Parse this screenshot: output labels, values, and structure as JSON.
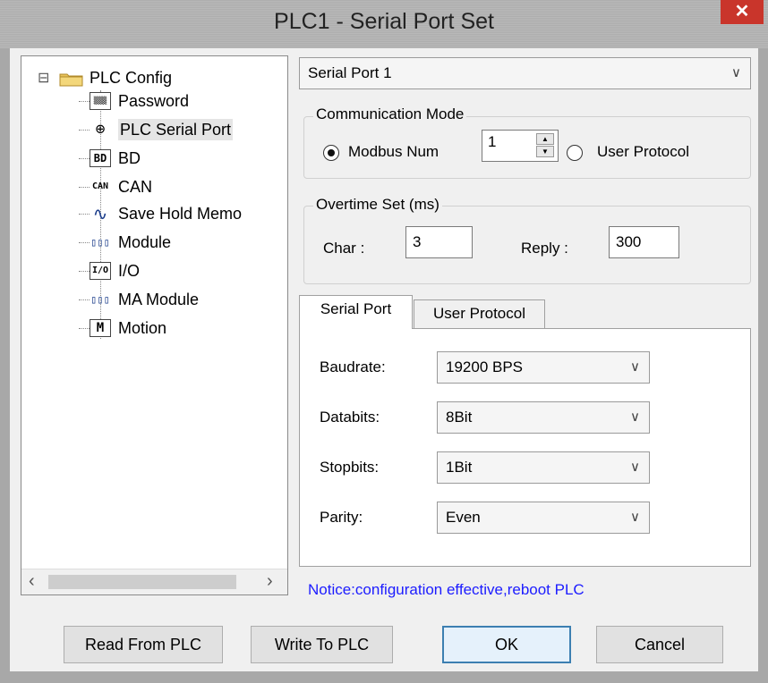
{
  "window": {
    "title": "PLC1 - Serial Port  Set",
    "close_glyph": "✕"
  },
  "tree": {
    "root": {
      "label": "PLC Config",
      "icon": "folder-icon",
      "expander": "⊟"
    },
    "items": [
      {
        "label": "Password",
        "icon_text": "▒▒▒"
      },
      {
        "label": "PLC Serial Port",
        "icon_text": "⊕"
      },
      {
        "label": "BD",
        "icon_text": "BD"
      },
      {
        "label": "CAN",
        "icon_text": "CAN"
      },
      {
        "label": "Save Hold Memo",
        "icon_text": "∿"
      },
      {
        "label": "Module",
        "icon_text": "▯▯▯"
      },
      {
        "label": "I/O",
        "icon_text": "I/O"
      },
      {
        "label": "MA Module",
        "icon_text": "▯▯▯"
      },
      {
        "label": "Motion",
        "icon_text": "M"
      }
    ],
    "scroll_left": "‹",
    "scroll_right": "›"
  },
  "port_select": {
    "value": "Serial Port 1",
    "chevron": "∨"
  },
  "comm_mode": {
    "title": "Communication Mode",
    "modbus_label": "Modbus Num",
    "modbus_value": "1",
    "user_protocol_label": "User Protocol"
  },
  "overtime": {
    "title": "Overtime Set (ms)",
    "char_label": "Char :",
    "char_value": "3",
    "reply_label": "Reply :",
    "reply_value": "300"
  },
  "tabs": {
    "serial_port": "Serial Port",
    "user_protocol": "User Protocol"
  },
  "settings": {
    "baudrate_label": "Baudrate:",
    "baudrate_value": "19200 BPS",
    "databits_label": "Databits:",
    "databits_value": "8Bit",
    "stopbits_label": "Stopbits:",
    "stopbits_value": "1Bit",
    "parity_label": "Parity:",
    "parity_value": "Even"
  },
  "notice": "Notice:configuration effective,reboot PLC",
  "buttons": {
    "read": "Read From PLC",
    "write": "Write To PLC",
    "ok": "OK",
    "cancel": "Cancel"
  },
  "colors": {
    "notice": "#1c1cff",
    "close": "#c9352b",
    "default_button_border": "#3c7fb1"
  }
}
